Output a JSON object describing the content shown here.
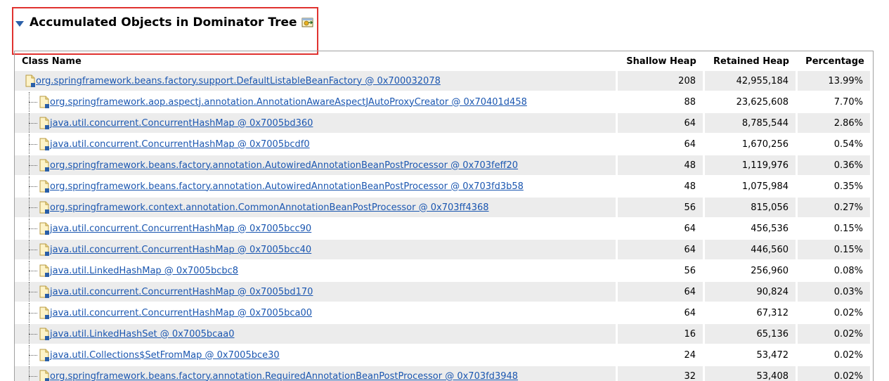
{
  "section": {
    "title": "Accumulated Objects in Dominator Tree"
  },
  "table": {
    "headers": {
      "class_name": "Class Name",
      "shallow_heap": "Shallow Heap",
      "retained_heap": "Retained Heap",
      "percentage": "Percentage"
    },
    "rows": [
      {
        "name": "org.springframework.beans.factory.support.DefaultListableBeanFactory @ 0x700032078",
        "shallow": "208",
        "retained": "42,955,184",
        "pct": "13.99%"
      },
      {
        "name": "org.springframework.aop.aspectj.annotation.AnnotationAwareAspectJAutoProxyCreator @ 0x70401d458",
        "shallow": "88",
        "retained": "23,625,608",
        "pct": "7.70%"
      },
      {
        "name": "java.util.concurrent.ConcurrentHashMap @ 0x7005bd360",
        "shallow": "64",
        "retained": "8,785,544",
        "pct": "2.86%"
      },
      {
        "name": "java.util.concurrent.ConcurrentHashMap @ 0x7005bcdf0",
        "shallow": "64",
        "retained": "1,670,256",
        "pct": "0.54%"
      },
      {
        "name": "org.springframework.beans.factory.annotation.AutowiredAnnotationBeanPostProcessor @ 0x703feff20",
        "shallow": "48",
        "retained": "1,119,976",
        "pct": "0.36%"
      },
      {
        "name": "org.springframework.beans.factory.annotation.AutowiredAnnotationBeanPostProcessor @ 0x703fd3b58",
        "shallow": "48",
        "retained": "1,075,984",
        "pct": "0.35%"
      },
      {
        "name": "org.springframework.context.annotation.CommonAnnotationBeanPostProcessor @ 0x703ff4368",
        "shallow": "56",
        "retained": "815,056",
        "pct": "0.27%"
      },
      {
        "name": "java.util.concurrent.ConcurrentHashMap @ 0x7005bcc90",
        "shallow": "64",
        "retained": "456,536",
        "pct": "0.15%"
      },
      {
        "name": "java.util.concurrent.ConcurrentHashMap @ 0x7005bcc40",
        "shallow": "64",
        "retained": "446,560",
        "pct": "0.15%"
      },
      {
        "name": "java.util.LinkedHashMap @ 0x7005bcbc8",
        "shallow": "56",
        "retained": "256,960",
        "pct": "0.08%"
      },
      {
        "name": "java.util.concurrent.ConcurrentHashMap @ 0x7005bd170",
        "shallow": "64",
        "retained": "90,824",
        "pct": "0.03%"
      },
      {
        "name": "java.util.concurrent.ConcurrentHashMap @ 0x7005bca00",
        "shallow": "64",
        "retained": "67,312",
        "pct": "0.02%"
      },
      {
        "name": "java.util.LinkedHashSet @ 0x7005bcaa0",
        "shallow": "16",
        "retained": "65,136",
        "pct": "0.02%"
      },
      {
        "name": "java.util.Collections$SetFromMap @ 0x7005bce30",
        "shallow": "24",
        "retained": "53,472",
        "pct": "0.02%"
      },
      {
        "name": "org.springframework.beans.factory.annotation.RequiredAnnotationBeanPostProcessor @ 0x703fd3948",
        "shallow": "32",
        "retained": "53,408",
        "pct": "0.02%"
      }
    ]
  }
}
